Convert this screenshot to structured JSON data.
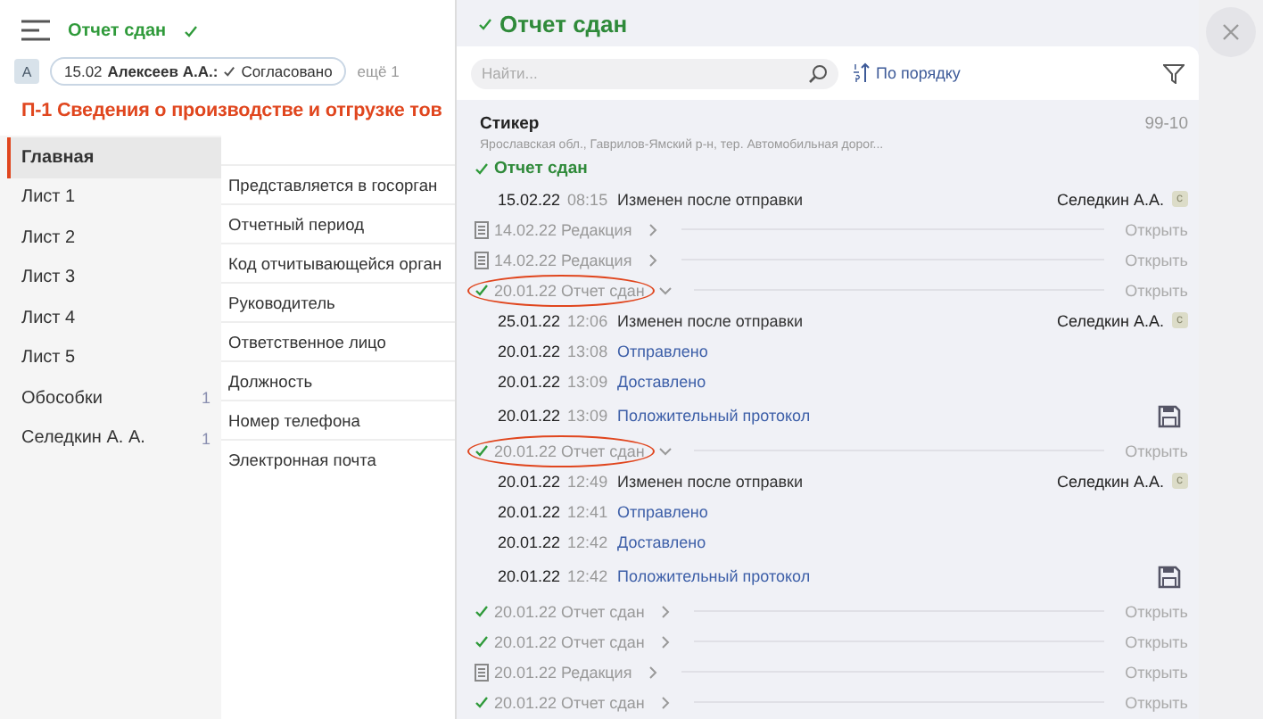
{
  "header": {
    "status": "Отчет сдан",
    "status_ok": true
  },
  "approval": {
    "avatar": "А",
    "date": "15.02",
    "person": "Алексеев А.А.:",
    "result": "Согласовано",
    "more": "ещё 1"
  },
  "title": "П-1 Сведения о производстве и отгрузке тов",
  "sidebar": {
    "items": [
      {
        "label": "Главная",
        "selected": true
      },
      {
        "label": "Лист 1",
        "selected": false
      },
      {
        "label": "Лист 2",
        "selected": false
      },
      {
        "label": "Лист 3",
        "selected": false
      },
      {
        "label": "Лист 4",
        "selected": false
      },
      {
        "label": "Лист 5",
        "selected": false
      },
      {
        "label": "Обособки",
        "selected": false,
        "count": "1"
      },
      {
        "label": "Селедкин А. А.",
        "selected": false,
        "count": "1"
      }
    ]
  },
  "form_rows": [
    "Представляется в госорган",
    "Отчетный период",
    "Код отчитывающейся орган",
    "Руководитель",
    "Ответственное лицо",
    "Должность",
    "Номер телефона",
    "Электронная почта"
  ],
  "drawer": {
    "title": "Отчет сдан",
    "search": {
      "placeholder": "Найти..."
    },
    "sort": "По порядку",
    "org": {
      "name": "Стикер",
      "code": "99-10",
      "address": "Ярославская обл., Гаврилов-Ямский р-н, тер. Автомобильная дорог...",
      "status": "Отчет сдан"
    },
    "history": [
      {
        "kind": "change",
        "date": "15.02.22",
        "time": "08:15",
        "text": "Изменен после отправки",
        "author": "Селедкин А.А.",
        "badge": "с"
      },
      {
        "kind": "revision",
        "label": "14.02.22 Редакция",
        "expanded": false,
        "highlighted": false,
        "action": "Открыть"
      },
      {
        "kind": "revision",
        "label": "14.02.22 Редакция",
        "expanded": false,
        "highlighted": false,
        "action": "Открыть"
      },
      {
        "kind": "report",
        "label": "20.01.22 Отчет сдан",
        "expanded": true,
        "highlighted": true,
        "action": "Открыть",
        "children": [
          {
            "kind": "change",
            "date": "25.01.22",
            "time": "12:06",
            "text": "Изменен после отправки",
            "author": "Селедкин А.А.",
            "badge": "с"
          },
          {
            "kind": "status",
            "date": "20.01.22",
            "time": "13:08",
            "text": "Отправлено"
          },
          {
            "kind": "status",
            "date": "20.01.22",
            "time": "13:09",
            "text": "Доставлено"
          },
          {
            "kind": "status",
            "date": "20.01.22",
            "time": "13:09",
            "text": "Положительный протокол",
            "file": true
          }
        ]
      },
      {
        "kind": "report",
        "label": "20.01.22 Отчет сдан",
        "expanded": true,
        "highlighted": true,
        "action": "Открыть",
        "children": [
          {
            "kind": "change",
            "date": "20.01.22",
            "time": "12:49",
            "text": "Изменен после отправки",
            "author": "Селедкин А.А.",
            "badge": "с"
          },
          {
            "kind": "status",
            "date": "20.01.22",
            "time": "12:41",
            "text": "Отправлено"
          },
          {
            "kind": "status",
            "date": "20.01.22",
            "time": "12:42",
            "text": "Доставлено"
          },
          {
            "kind": "status",
            "date": "20.01.22",
            "time": "12:42",
            "text": "Положительный протокол",
            "file": true
          }
        ]
      },
      {
        "kind": "report",
        "label": "20.01.22 Отчет сдан",
        "expanded": false,
        "highlighted": false,
        "action": "Открыть"
      },
      {
        "kind": "report",
        "label": "20.01.22 Отчет сдан",
        "expanded": false,
        "highlighted": false,
        "action": "Открыть"
      },
      {
        "kind": "revision",
        "label": "20.01.22 Редакция",
        "expanded": false,
        "highlighted": false,
        "action": "Открыть"
      },
      {
        "kind": "report",
        "label": "20.01.22 Отчет сдан",
        "expanded": false,
        "highlighted": false,
        "action": "Открыть"
      }
    ]
  }
}
